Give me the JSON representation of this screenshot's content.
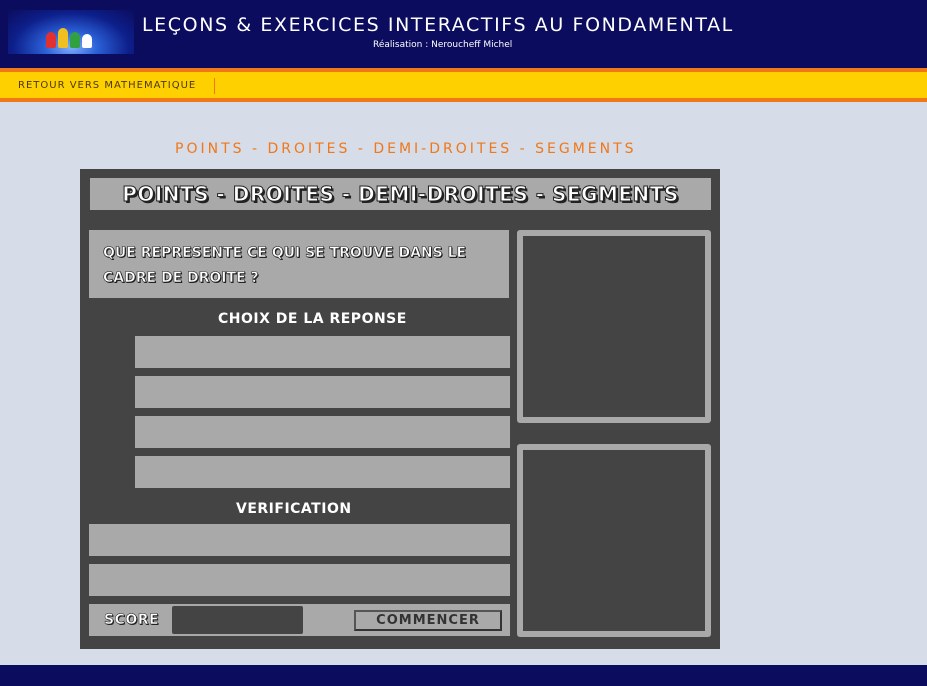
{
  "header": {
    "title": "LEÇONS & EXERCICES INTERACTIFS AU FONDAMENTAL",
    "author": "Réalisation : Neroucheff Michel",
    "logo_icon": "cartoon-characters-logo"
  },
  "nav": {
    "back_link": "RETOUR VERS MATHEMATIQUE"
  },
  "page": {
    "heading": "POINTS - DROITES - DEMI-DROITES - SEGMENTS"
  },
  "exercise": {
    "title": "POINTS - DROITES - DEMI-DROITES - SEGMENTS",
    "question": "QUE REPRESENTE CE QUI SE TROUVE DANS LE CADRE DE DROITE ?",
    "choices_label": "CHOIX DE LA REPONSE",
    "choices": [
      "",
      "",
      "",
      ""
    ],
    "verification_label": "VERIFICATION",
    "verification_lines": [
      "",
      ""
    ],
    "score_label": "SCORE",
    "score_value": "",
    "start_button": "COMMENCER"
  },
  "colors": {
    "header_bg": "#0b0c5e",
    "nav_bg": "#ffd000",
    "nav_border": "#f07818",
    "heading_text": "#f07818",
    "panel_bg": "#444444",
    "box_bg": "#a9a9a9",
    "page_bg": "#d6dce8"
  }
}
